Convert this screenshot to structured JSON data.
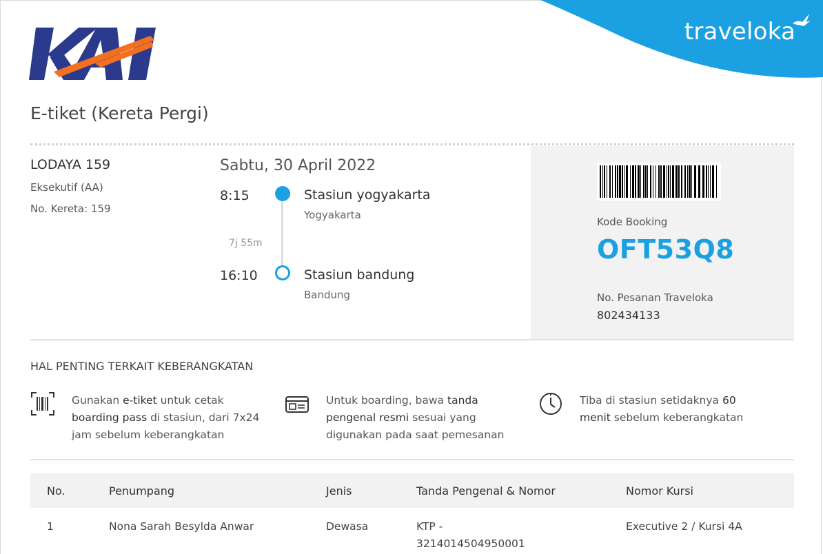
{
  "header": {
    "brand_right": "traveloka",
    "brand_left_logo": "kai-logo"
  },
  "title": "E-tiket (Kereta Pergi)",
  "train": {
    "name": "LODAYA 159",
    "class": "Eksekutif (AA)",
    "number": "No. Kereta: 159"
  },
  "journey": {
    "date": "Sabtu, 30 April 2022",
    "departure_time": "8:15",
    "duration": "7j 55m",
    "arrival_time": "16:10",
    "departure_station": "Stasiun yogyakarta",
    "departure_city": "Yogyakarta",
    "arrival_station": "Stasiun bandung",
    "arrival_city": "Bandung"
  },
  "booking": {
    "code_label": "Kode Booking",
    "code": "OFT53Q8",
    "order_label": "No. Pesanan Traveloka",
    "order_no": "802434133"
  },
  "notes": {
    "title": "HAL PENTING TERKAIT KEBERANGKATAN",
    "items": [
      {
        "icon": "barcode-scan-icon",
        "parts": [
          "Gunakan ",
          "e-tiket",
          " untuk cetak ",
          "boarding pass",
          " di stasiun, dari ",
          "7x24 jam sebelum keberangkatan"
        ]
      },
      {
        "icon": "id-card-icon",
        "parts": [
          "Untuk boarding, bawa ",
          "tanda pengenal resmi",
          " sesuai yang digunakan pada saat pemesanan"
        ]
      },
      {
        "icon": "clock-icon",
        "parts": [
          "Tiba di stasiun setidaknya ",
          "60 menit",
          " sebelum keberangkatan"
        ]
      }
    ]
  },
  "passengers": {
    "headers": [
      "No.",
      "Penumpang",
      "Jenis",
      "Tanda Pengenal & Nomor",
      "Nomor Kursi"
    ],
    "rows": [
      {
        "no": "1",
        "name": "Nona Sarah Besylda Anwar",
        "type": "Dewasa",
        "id_line1": "KTP -",
        "id_line2": "3214014504950001",
        "seat": "Executive 2 / Kursi 4A"
      }
    ]
  },
  "colors": {
    "accent_blue": "#1ba0e2",
    "kai_navy": "#2b3a8c",
    "kai_orange": "#f37021"
  }
}
